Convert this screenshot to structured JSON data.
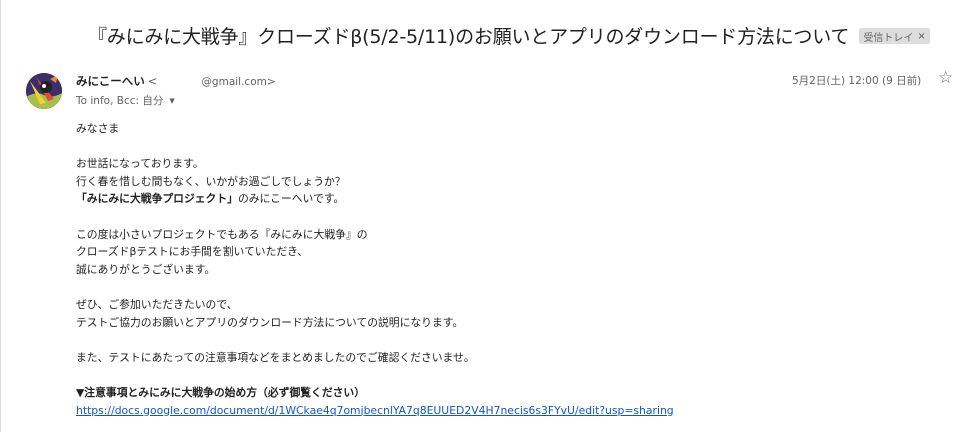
{
  "email": {
    "subject": "『みにみに大戦争』クローズドβ(5/2-5/11)のお願いとアプリのダウンロード方法について",
    "label": "受信トレイ",
    "label_close": "×",
    "sender": {
      "name": "みにこーへい",
      "lt": "<",
      "email": "@gmail.com>",
      "avatar_icon": "avatar-image"
    },
    "recipients": "To info, Bcc: 自分",
    "recipients_caret": "▼",
    "date": "5月2日(土) 12:00 (9 日前)",
    "star_icon": "☆"
  },
  "body": {
    "greeting": "みなさま",
    "para1": [
      "お世話になっております。",
      "行く春を惜しむ間もなく、いかがお過ごしでしょうか？"
    ],
    "project_bold": "「みにみに大戦争プロジェクト」",
    "project_rest": "のみにこーへいです。",
    "para2": [
      "この度は小さいプロジェクトでもある『みにみに大戦争』の",
      "クローズドβテストにお手間を割いていただき、",
      "誠にありがとうございます。"
    ],
    "para3": [
      "ぜひ、ご参加いただきたいので、",
      "テストご協力のお願いとアプリのダウンロード方法についての説明になります。"
    ],
    "para4": "また、テストにあたっての注意事項などをまとめましたのでご確認くださいませ。",
    "section_title": "▼注意事項とみにみに大戦争の始め方（必ず御覧ください）",
    "link": "https://docs.google.com/document/d/1WCkae4q7omjbecnlYA7q8EUUED2V4H7necis6s3FYvU/edit?usp=sharing"
  },
  "colors": {
    "link": "#1155cc",
    "chip_bg": "#dddddd",
    "meta_text": "#5f6368"
  }
}
